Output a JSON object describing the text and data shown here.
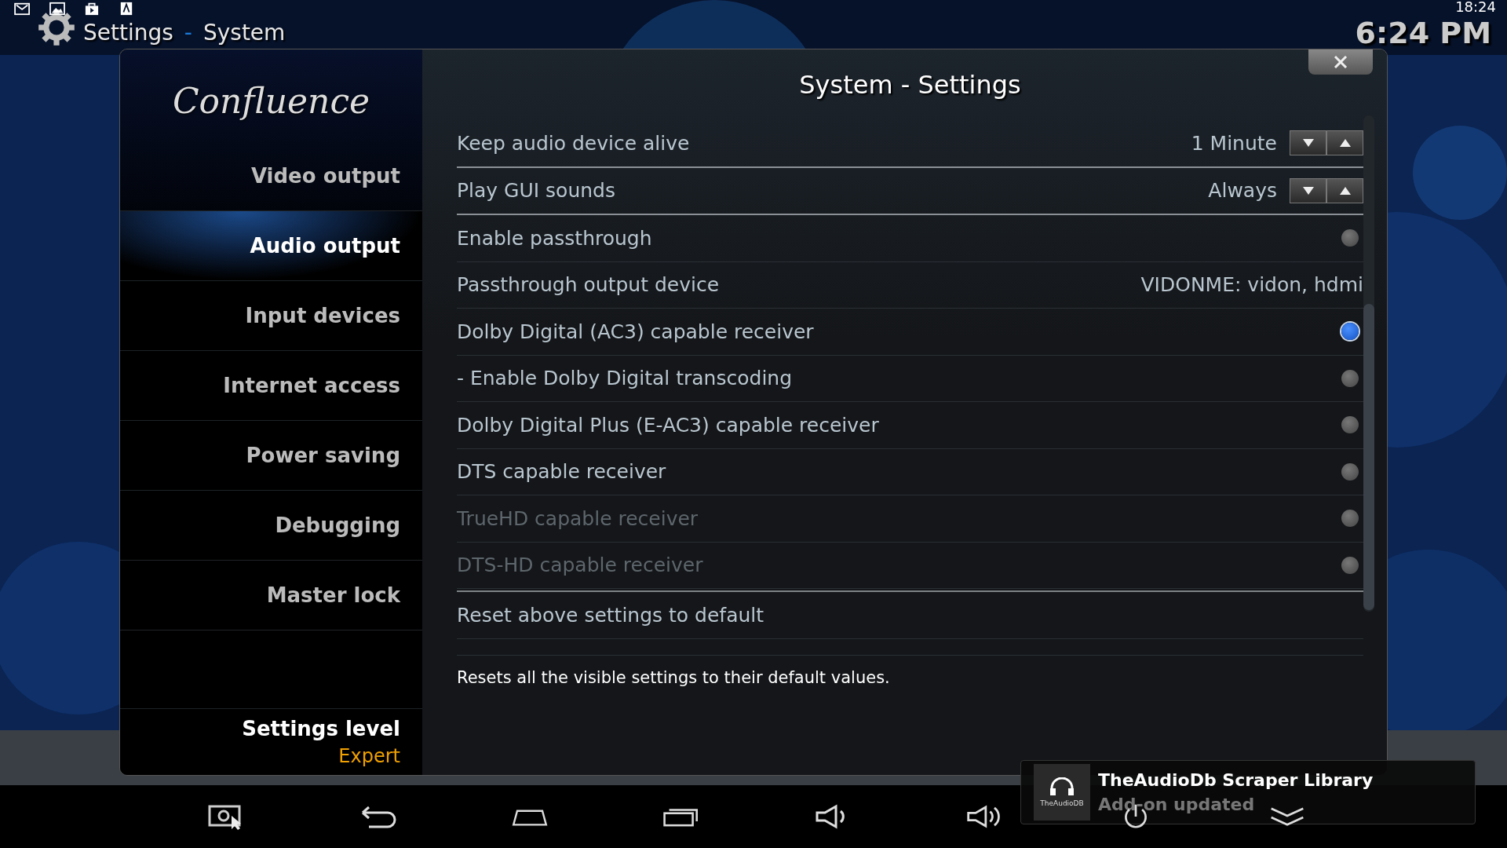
{
  "header": {
    "section": "Settings",
    "separator": "-",
    "page": "System",
    "clock": "6:24 PM",
    "status_time": "18:24"
  },
  "sidebar": {
    "logo": "Confluence",
    "items": [
      {
        "label": "Video output",
        "selected": false
      },
      {
        "label": "Audio output",
        "selected": true
      },
      {
        "label": "Input devices",
        "selected": false
      },
      {
        "label": "Internet access",
        "selected": false
      },
      {
        "label": "Power saving",
        "selected": false
      },
      {
        "label": "Debugging",
        "selected": false
      },
      {
        "label": "Master lock",
        "selected": false
      }
    ],
    "level_label": "Settings level",
    "level_value": "Expert"
  },
  "dialog": {
    "title": "System - Settings"
  },
  "settings": [
    {
      "kind": "spinner",
      "label": "Keep audio device alive",
      "value": "1 Minute",
      "disabled": false
    },
    {
      "kind": "spinner",
      "label": "Play GUI sounds",
      "value": "Always",
      "disabled": false
    },
    {
      "kind": "toggle",
      "label": "Enable passthrough",
      "on": false,
      "disabled": false
    },
    {
      "kind": "text",
      "label": "Passthrough output device",
      "value": "VIDONME: vidon, hdmi",
      "disabled": false
    },
    {
      "kind": "toggle",
      "label": "Dolby Digital (AC3) capable receiver",
      "on": true,
      "disabled": false
    },
    {
      "kind": "toggle",
      "label": "- Enable Dolby Digital transcoding",
      "on": false,
      "disabled": false
    },
    {
      "kind": "toggle",
      "label": "Dolby Digital Plus (E-AC3) capable receiver",
      "on": false,
      "disabled": false
    },
    {
      "kind": "toggle",
      "label": "DTS capable receiver",
      "on": false,
      "disabled": false
    },
    {
      "kind": "toggle",
      "label": "TrueHD capable receiver",
      "on": false,
      "disabled": true
    },
    {
      "kind": "toggle",
      "label": "DTS-HD capable receiver",
      "on": false,
      "disabled": true
    },
    {
      "kind": "action",
      "label": "Reset above settings to default",
      "disabled": false
    }
  ],
  "description": "Resets all the visible settings to their default values.",
  "notification": {
    "logo": "TheAudioDB",
    "title": "TheAudioDb Scraper Library",
    "message": "Add-on updated"
  }
}
